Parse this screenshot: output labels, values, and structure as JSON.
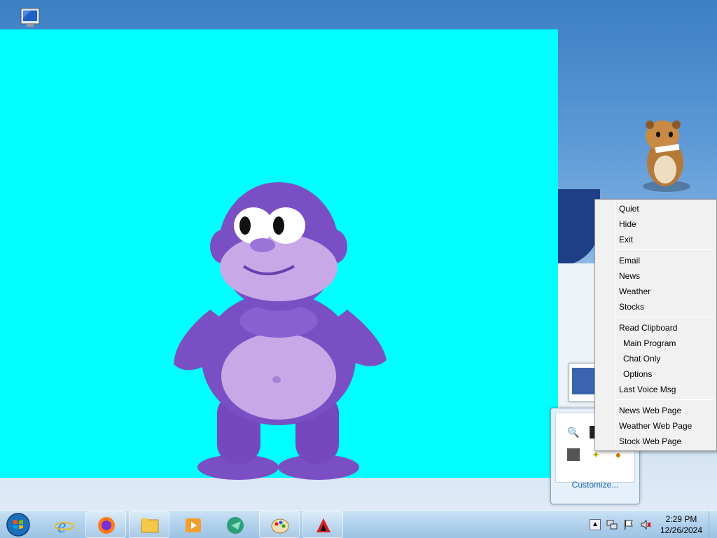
{
  "context_menu": {
    "groups": [
      [
        {
          "label": "Quiet"
        },
        {
          "label": "Hide"
        },
        {
          "label": "Exit"
        }
      ],
      [
        {
          "label": "Email"
        },
        {
          "label": "News"
        },
        {
          "label": "Weather"
        },
        {
          "label": "Stocks"
        }
      ],
      [
        {
          "label": "Read Clipboard"
        },
        {
          "label": "Main Program"
        },
        {
          "label": "Chat Only"
        },
        {
          "label": "Options"
        },
        {
          "label": "Last Voice Msg"
        }
      ],
      [
        {
          "label": "News Web Page"
        },
        {
          "label": "Weather Web Page"
        },
        {
          "label": "Stock Web Page"
        }
      ]
    ]
  },
  "tray_overflow": {
    "customize_label": "Customize..."
  },
  "taskbar": {
    "apps": [
      {
        "name": "internet-explorer-icon"
      },
      {
        "name": "firefox-icon"
      },
      {
        "name": "file-explorer-icon"
      },
      {
        "name": "media-player-icon"
      },
      {
        "name": "bonzi-parrot-icon"
      },
      {
        "name": "paint-icon"
      },
      {
        "name": "bonzi-app-icon"
      }
    ],
    "clock": {
      "time": "2:29 PM",
      "date": "12/26/2024"
    }
  },
  "colors": {
    "bonzi_window_bg": "#00ffff",
    "gorilla": "#7b4fc4",
    "menu_bg": "#f1f1f1"
  }
}
